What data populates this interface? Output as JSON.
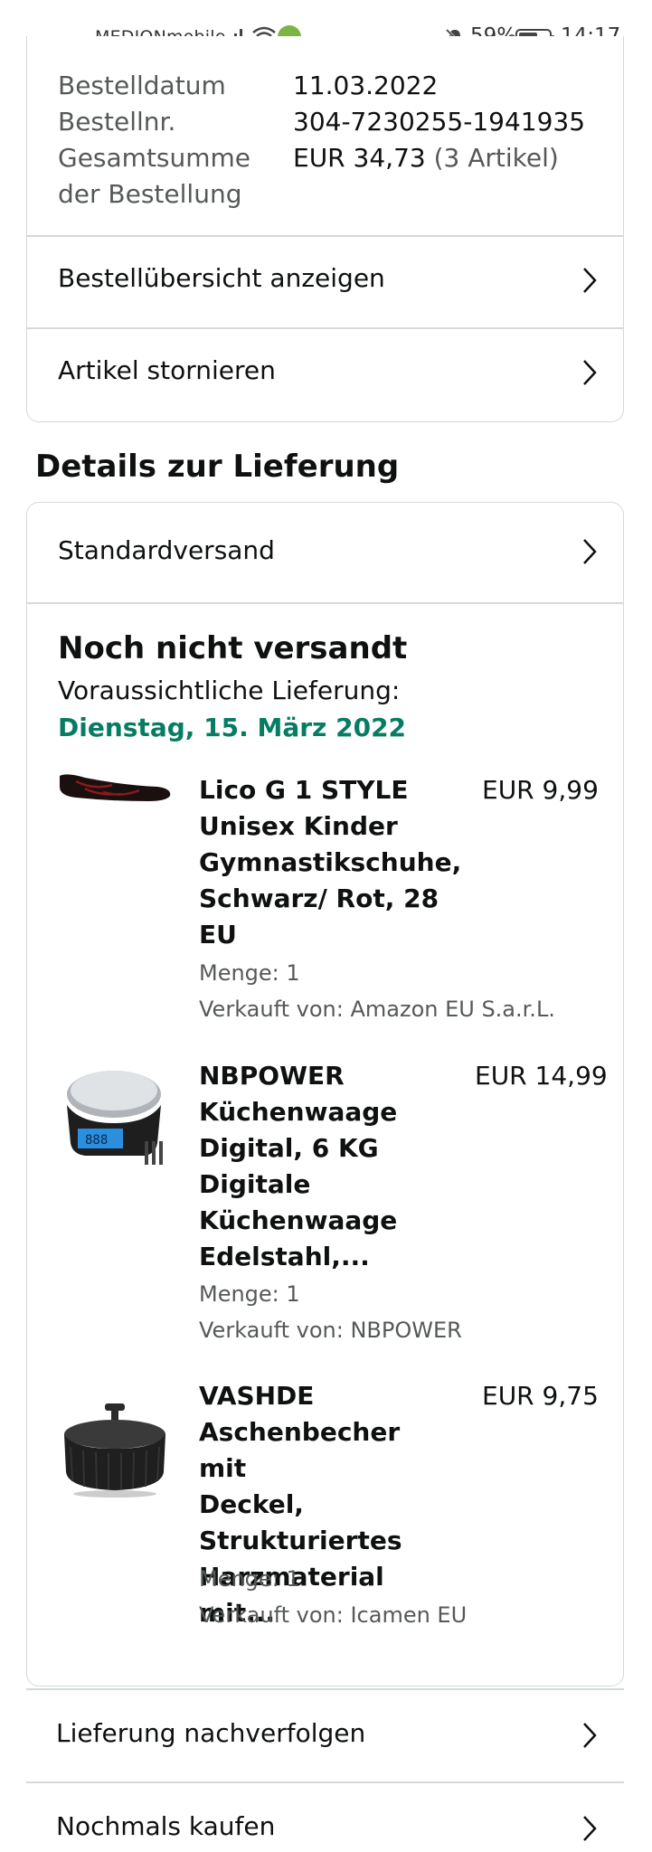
{
  "status_bar": {
    "carrier": "MEDIONmobile",
    "battery": "59%",
    "time": "14:17"
  },
  "order": {
    "date_label": "Bestelldatum",
    "date_value": "11.03.2022",
    "number_label": "Bestellnr.",
    "number_value": "304-7230255-1941935",
    "total_label_line1": "Gesamtsumme",
    "total_label_line2": "der Bestellung",
    "total_value": "EUR 34,73",
    "total_count": "(3 Artikel)"
  },
  "actions": {
    "overview": "Bestellübersicht anzeigen",
    "cancel": "Artikel stornieren"
  },
  "delivery": {
    "section_title": "Details zur Lieferung",
    "method": "Standardversand",
    "status": "Noch nicht versandt",
    "eta_label": "Voraussichtliche Lieferung:",
    "eta_date": "Dienstag, 15. März 2022",
    "colors": {
      "eta_green": "#067d62"
    }
  },
  "items": [
    {
      "title_lines": [
        "Lico G 1 STYLE",
        "Unisex Kinder",
        "Gymnastikschuhe,",
        "Schwarz/ Rot, 28",
        "EU"
      ],
      "price": "EUR 9,99",
      "qty": "Menge: 1",
      "seller": "Verkauft von: Amazon EU S.a.r.L.",
      "image": "shoe-icon"
    },
    {
      "title_lines": [
        "NBPOWER",
        "Küchenwaage",
        "Digital, 6 KG",
        "Digitale",
        "Küchenwaage",
        "Edelstahl,..."
      ],
      "price": "EUR 14,99",
      "qty": "Menge: 1",
      "seller": "Verkauft von: NBPOWER",
      "image": "kitchen-scale-icon"
    },
    {
      "title_lines": [
        "VASHDE",
        "Aschenbecher mit",
        "Deckel,",
        "Strukturiertes",
        "Harzmaterial mit..."
      ],
      "price": "EUR 9,75",
      "qty": "Menge: 1",
      "seller": "Verkauft von: Icamen EU",
      "image": "ashtray-icon"
    }
  ],
  "footer_actions": {
    "track": "Lieferung nachverfolgen",
    "buy_again": "Nochmals kaufen"
  }
}
